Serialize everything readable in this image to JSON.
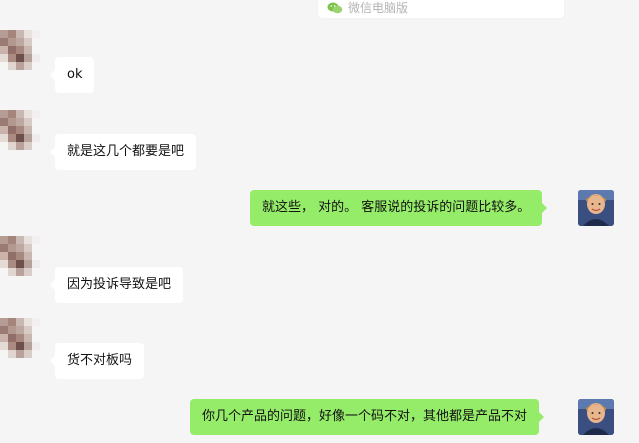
{
  "source": {
    "text": "微信电脑版",
    "icon": "wechat-icon"
  },
  "messages": [
    {
      "direction": "in",
      "text": "ok"
    },
    {
      "direction": "in",
      "text": "就是这几个都要是吧"
    },
    {
      "direction": "out",
      "text": "就这些， 对的。 客服说的投诉的问题比较多。"
    },
    {
      "direction": "in",
      "text": "因为投诉导致是吧"
    },
    {
      "direction": "in",
      "text": "货不对板吗"
    },
    {
      "direction": "out",
      "text": "你几个产品的问题，好像一个码不对，其他都是产品不对"
    }
  ],
  "colors": {
    "background": "#f5f5f5",
    "incoming_bubble": "#ffffff",
    "outgoing_bubble": "#95ec69",
    "wechat_green": "#7bc34a"
  }
}
